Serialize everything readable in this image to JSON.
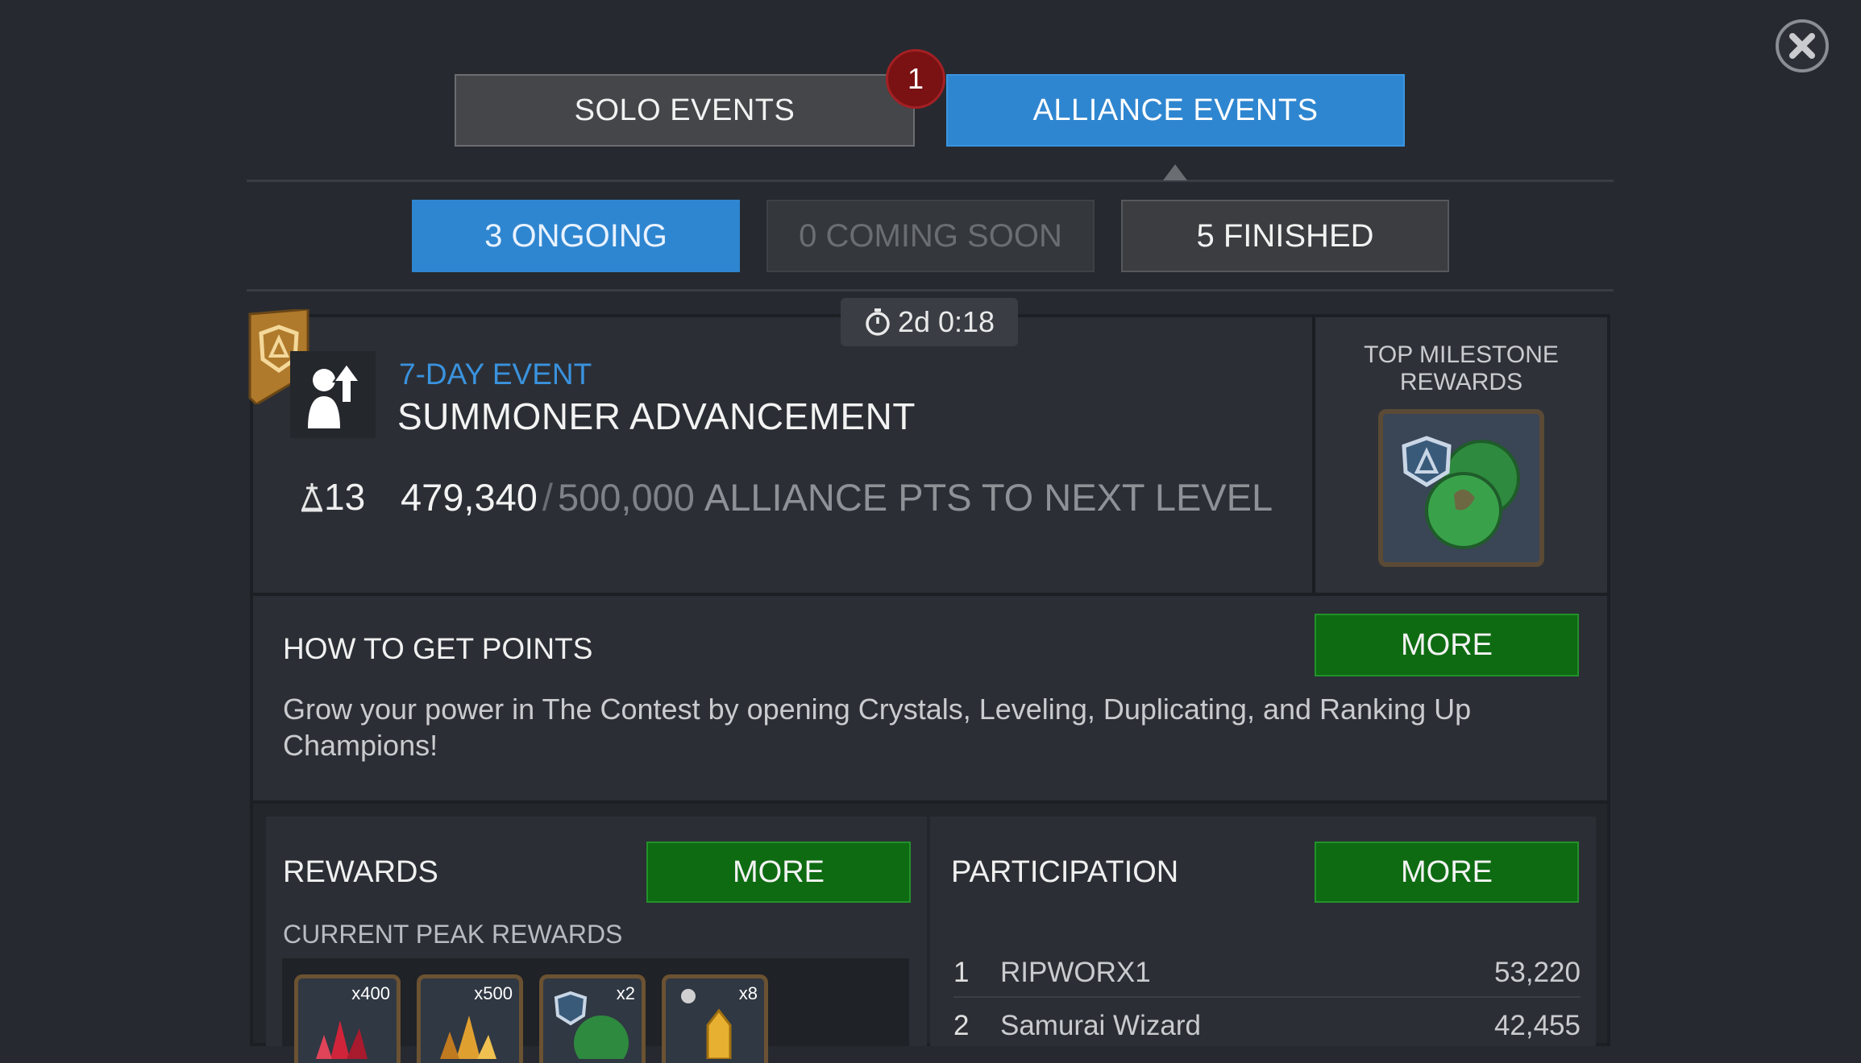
{
  "tabs": {
    "solo_label": "SOLO EVENTS",
    "alliance_label": "ALLIANCE EVENTS",
    "solo_badge": "1"
  },
  "subtabs": {
    "ongoing": "3 ONGOING",
    "coming_soon": "0 COMING SOON",
    "finished": "5 FINISHED"
  },
  "event": {
    "timer": "2d 0:18",
    "type": "7-DAY EVENT",
    "title": "SUMMONER ADVANCEMENT",
    "level": "13",
    "current_points": "479,340",
    "separator": "/",
    "target_points": "500,000",
    "points_label": "ALLIANCE PTS TO NEXT LEVEL",
    "progress_fraction": 0.9587
  },
  "milestone": {
    "title_line1": "TOP MILESTONE",
    "title_line2": "REWARDS"
  },
  "how_to": {
    "title": "HOW TO GET POINTS",
    "more_label": "MORE",
    "description": "Grow your power in The Contest by opening Crystals, Leveling, Duplicating, and Ranking Up Champions!"
  },
  "rewards": {
    "title": "REWARDS",
    "more_label": "MORE",
    "peak_title": "CURRENT PEAK REWARDS",
    "items": [
      {
        "icon": "red-shard-icon",
        "qty": "x400"
      },
      {
        "icon": "gold-shard-icon",
        "qty": "x500"
      },
      {
        "icon": "alliance-orb-icon",
        "qty": "x2"
      },
      {
        "icon": "crystal-icon",
        "qty": "x8"
      }
    ]
  },
  "participation": {
    "title": "PARTICIPATION",
    "more_label": "MORE",
    "rows": [
      {
        "rank": "1",
        "name": "RIPWORX1",
        "score": "53,220"
      },
      {
        "rank": "2",
        "name": "Samurai Wizard",
        "score": "42,455"
      }
    ]
  },
  "colors": {
    "accent_blue": "#2f86d0",
    "more_green": "#0e6b12",
    "badge_red": "#7a1113"
  }
}
